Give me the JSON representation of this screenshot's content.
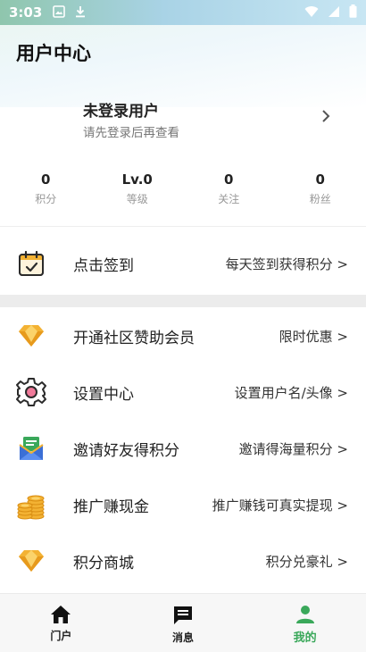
{
  "status_bar": {
    "time": "3:03"
  },
  "header": {
    "title": "用户中心"
  },
  "profile": {
    "name": "未登录用户",
    "hint": "请先登录后再查看"
  },
  "stats": [
    {
      "value": "0",
      "label": "积分"
    },
    {
      "value": "Lv.0",
      "label": "等级"
    },
    {
      "value": "0",
      "label": "关注"
    },
    {
      "value": "0",
      "label": "粉丝"
    }
  ],
  "checkin": {
    "label": "点击签到",
    "right": "每天签到获得积分 >"
  },
  "menu": [
    {
      "label": "开通社区赞助会员",
      "right": "限时优惠 >",
      "icon": "diamond-icon"
    },
    {
      "label": "设置中心",
      "right": "设置用户名/头像 >",
      "icon": "gear-icon"
    },
    {
      "label": "邀请好友得积分",
      "right": "邀请得海量积分 >",
      "icon": "envelope-icon"
    },
    {
      "label": "推广赚现金",
      "right": "推广赚钱可真实提现 >",
      "icon": "coins-icon"
    },
    {
      "label": "积分商城",
      "right": "积分兑豪礼 >",
      "icon": "diamond-icon"
    }
  ],
  "tabs": [
    {
      "label": "门户",
      "icon": "home-icon"
    },
    {
      "label": "消息",
      "icon": "message-icon"
    },
    {
      "label": "我的",
      "icon": "person-icon"
    }
  ],
  "colors": {
    "accent": "#3aa85a",
    "gold": "#f3b233",
    "muted": "#999999"
  }
}
